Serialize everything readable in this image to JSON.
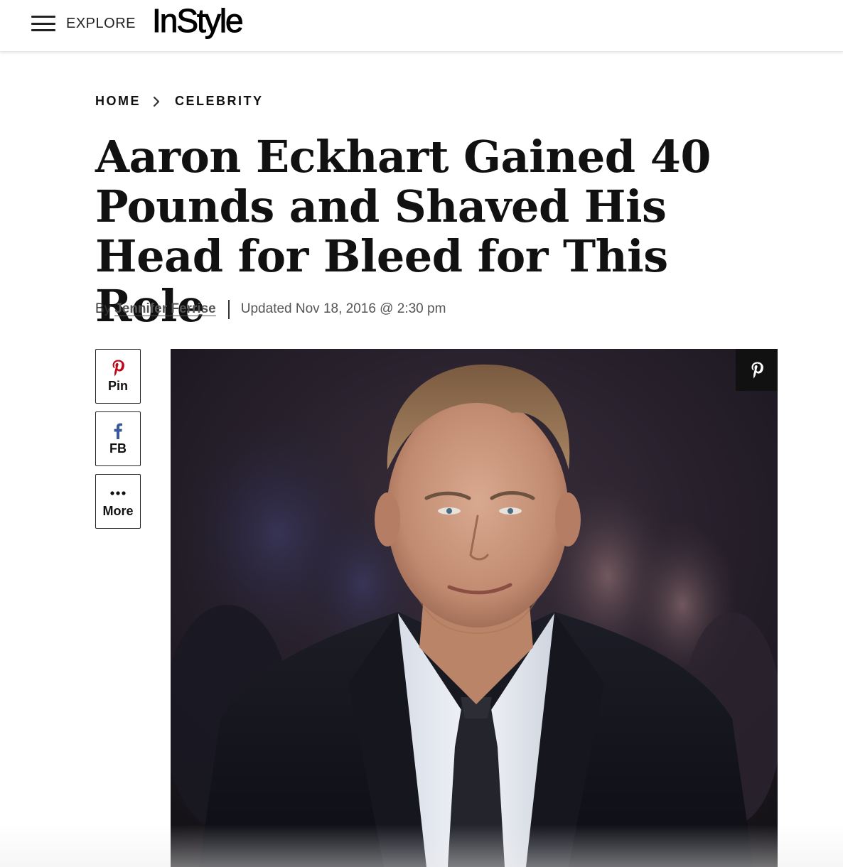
{
  "header": {
    "explore_label": "EXPLORE",
    "logo_text": "InStyle"
  },
  "breadcrumb": {
    "home": "HOME",
    "section": "CELEBRITY"
  },
  "article": {
    "title": "Aaron Eckhart Gained 40 Pounds and Shaved His Head for Bleed for This Role",
    "byline_prefix": "By",
    "author": "Jennifer Ferrise",
    "updated": "Updated Nov 18, 2016 @ 2:30 pm"
  },
  "share": {
    "pin_label": "Pin",
    "fb_label": "FB",
    "more_label": "More"
  },
  "colors": {
    "pinterest": "#bd081c",
    "facebook": "#3b5998"
  }
}
